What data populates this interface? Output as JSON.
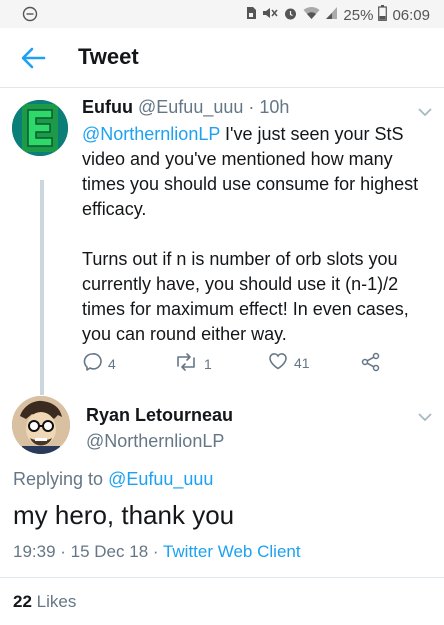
{
  "status_bar": {
    "battery": "25%",
    "time": "06:09",
    "icons": [
      "minus-circle-icon",
      "sim-icon",
      "mute-icon",
      "alarm-icon",
      "wifi-icon",
      "signal-icon",
      "battery-icon"
    ]
  },
  "app_bar": {
    "title": "Tweet",
    "back_icon": "back-arrow-icon"
  },
  "tweet1": {
    "name": "Eufuu",
    "handle": "@Eufuu_uuu",
    "time": "· 10h",
    "mention": "@NorthernlionLP",
    "line1": " I've just seen your StS video and you've mentioned how many times you should use consume for highest efficacy.",
    "line2": "Turns out if n is number of orb slots you currently have, you should use it (n-1)/2 times for maximum effect! In even cases, you can round either way.",
    "reply_count": "4",
    "retweet_count": "1",
    "like_count": "41"
  },
  "tweet2": {
    "name": "Ryan Letourneau",
    "handle": "@NorthernlionLP",
    "replying_prefix": "Replying to ",
    "replying_to": "@Eufuu_uuu",
    "text": "my hero, thank you",
    "datetime": "19:39 · 15 Dec 18 · ",
    "client": "Twitter Web Client",
    "likes_count": "22",
    "likes_label": " Likes"
  },
  "colors": {
    "accent": "#1da1f2",
    "text": "#14171a",
    "muted": "#657786",
    "avatar1": "#0b7e78"
  }
}
